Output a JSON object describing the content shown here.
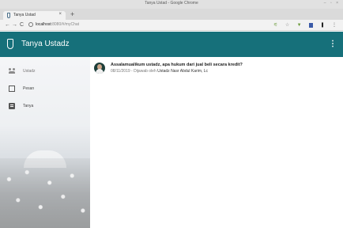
{
  "browser": {
    "window_title": "Tanya Ustad - Google Chrome",
    "window_controls": "– ▫ ×",
    "tab_title": "Tanya Ustad",
    "tab_close": "×",
    "new_tab": "+",
    "url_host": "localhost",
    "url_path": ":8080/#/myChat",
    "nav": {
      "back": "←",
      "forward": "→",
      "reload": "C"
    },
    "extensions": [
      "bookmark-star-icon",
      "filter-icon",
      "blue-extension-icon",
      "dark-extension-icon",
      "menu-icon"
    ]
  },
  "appbar": {
    "title": "Tanya Ustadz",
    "menu_glyph": "⋮",
    "color": "#16707a"
  },
  "sidebar": {
    "items": [
      {
        "label": "Ustadz",
        "icon": "people-icon"
      },
      {
        "label": "Pesan",
        "icon": "inbox-icon"
      },
      {
        "label": "Tanya",
        "icon": "chat-icon"
      }
    ]
  },
  "messages": [
    {
      "question": "Assalamualikum ustadz, apa hukum dari jual beli secara kredit?",
      "meta_prefix": "08/11/2019 - Dijawab oleh",
      "answered_by": "Ustadz Nasr Abdul Karim, Lc"
    }
  ]
}
